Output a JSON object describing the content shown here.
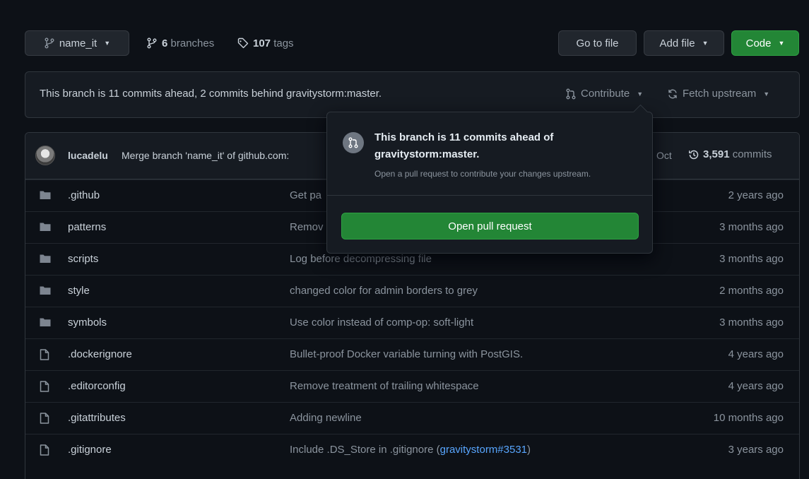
{
  "branch_selector": {
    "label": "name_it"
  },
  "branches": {
    "count": "6",
    "label": "branches"
  },
  "tags": {
    "count": "107",
    "label": "tags"
  },
  "toolbar": {
    "go_to_file": "Go to file",
    "add_file": "Add file",
    "code": "Code"
  },
  "ahead_bar": {
    "text": "This branch is 11 commits ahead, 2 commits behind gravitystorm:master.",
    "contribute": "Contribute",
    "fetch_upstream": "Fetch upstream"
  },
  "latest_commit": {
    "author": "lucadelu",
    "message": "Merge branch 'name_it' of github.com:",
    "date": "Oct",
    "count": "3,591",
    "count_label": "commits"
  },
  "popover": {
    "title": "This branch is 11 commits ahead of gravitystorm:master.",
    "subtitle": "Open a pull request to contribute your changes upstream.",
    "button": "Open pull request"
  },
  "files": [
    {
      "type": "folder",
      "name": ".github",
      "message": "Get pa",
      "link": "",
      "message_after": "",
      "age": "2 years ago"
    },
    {
      "type": "folder",
      "name": "patterns",
      "message": "Remov",
      "link": "",
      "message_after": "",
      "age": "3 months ago"
    },
    {
      "type": "folder",
      "name": "scripts",
      "message": "Log before decompressing file",
      "link": "",
      "message_after": "",
      "age": "3 months ago"
    },
    {
      "type": "folder",
      "name": "style",
      "message": "changed color for admin borders to grey",
      "link": "",
      "message_after": "",
      "age": "2 months ago"
    },
    {
      "type": "folder",
      "name": "symbols",
      "message": "Use color instead of comp-op: soft-light",
      "link": "",
      "message_after": "",
      "age": "3 months ago"
    },
    {
      "type": "file",
      "name": ".dockerignore",
      "message": "Bullet-proof Docker variable turning with PostGIS.",
      "link": "",
      "message_after": "",
      "age": "4 years ago"
    },
    {
      "type": "file",
      "name": ".editorconfig",
      "message": "Remove treatment of trailing whitespace",
      "link": "",
      "message_after": "",
      "age": "4 years ago"
    },
    {
      "type": "file",
      "name": ".gitattributes",
      "message": "Adding newline",
      "link": "",
      "message_after": "",
      "age": "10 months ago"
    },
    {
      "type": "file",
      "name": ".gitignore",
      "message": "Include .DS_Store in .gitignore (",
      "link": "gravitystorm#3531",
      "message_after": ")",
      "age": "3 years ago"
    }
  ],
  "colors": {
    "background": "#0d1117",
    "panel": "#161b22",
    "border": "#30363d",
    "text": "#c9d1d9",
    "muted": "#8b949e",
    "link": "#58a6ff",
    "green": "#238636"
  }
}
